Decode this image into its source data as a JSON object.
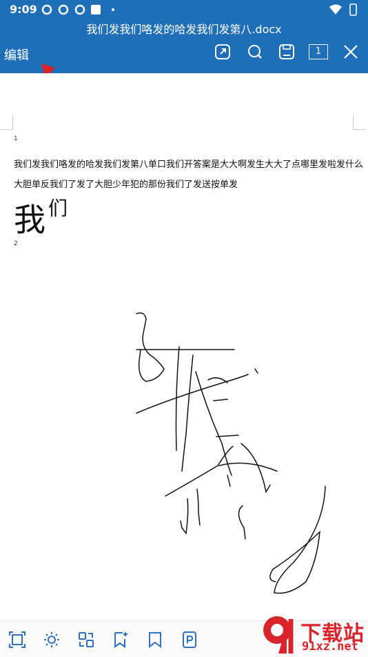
{
  "status": {
    "time": "9:09",
    "app_icons": [
      "sync-icon",
      "sync-icon",
      "sync-icon",
      "square-icon",
      "dot-icon"
    ],
    "right_icons": [
      "wifi-icon",
      "battery-icon"
    ]
  },
  "header": {
    "title": "我们发我们咯发的哈发我们发第八.docx",
    "edit_label": "编辑",
    "page_count": "1",
    "toolbar_icons": [
      "share-icon",
      "search-icon",
      "save-icon",
      "page-count-icon",
      "close-icon"
    ]
  },
  "document": {
    "page1_number": "1",
    "line1": "我们发我们咯发的哈发我们发第八单口我们开答案是大大啊发生大大了点哪里发啦发什么",
    "line2": "大胆单反我们了发了大胆少年犯的那份我们了发送按单发",
    "large_text_a": "我",
    "large_text_b": "们",
    "page2_number": "2"
  },
  "bottom_bar": {
    "icons": [
      "fit-page-icon",
      "brightness-icon",
      "convert-icon",
      "bookmark-add-icon",
      "bookmark-icon",
      "pdf-icon"
    ]
  },
  "watermark": {
    "brand_line1": "下载站",
    "brand_line2": "91xz.net"
  },
  "colors": {
    "header_bg": "#1f6fb8",
    "arrow": "#e02020",
    "watermark_red": "#d8242a"
  }
}
